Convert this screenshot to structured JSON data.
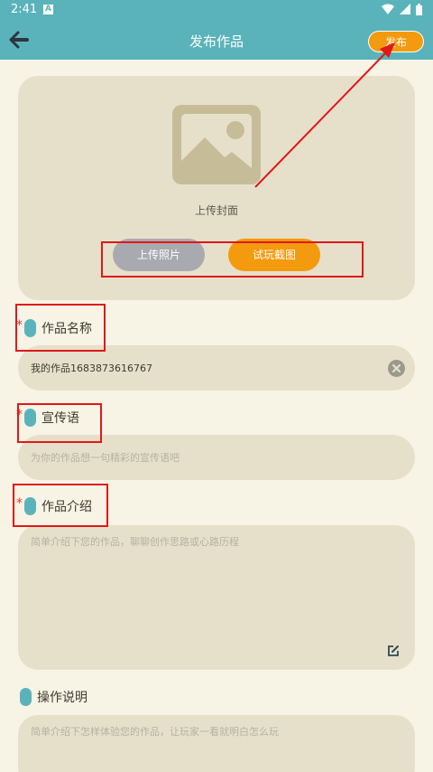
{
  "status_bar": {
    "time": "2:41",
    "notif_letter": "A"
  },
  "header": {
    "title": "发布作品",
    "publish_label": "发布"
  },
  "cover": {
    "upload_cover_label": "上传封面",
    "upload_photo_label": "上传照片",
    "screenshot_label": "试玩截图"
  },
  "fields": {
    "name": {
      "label": "作品名称",
      "required_mark": "*",
      "value": "我的作品1683873616767"
    },
    "slogan": {
      "label": "宣传语",
      "required_mark": "*",
      "placeholder": "为你的作品想一句精彩的宣传语吧"
    },
    "intro": {
      "label": "作品介绍",
      "required_mark": "*",
      "placeholder": "简单介绍下您的作品，聊聊创作思路或心路历程"
    },
    "instructions": {
      "label": "操作说明",
      "placeholder": "简单介绍下怎样体验您的作品，让玩家一看就明白怎么玩"
    }
  },
  "colors": {
    "accent": "#5ab3ba",
    "orange": "#f49a0e",
    "field_bg": "#e6e0cb",
    "page_bg": "#f7f3e5",
    "annotation": "#e01818"
  }
}
